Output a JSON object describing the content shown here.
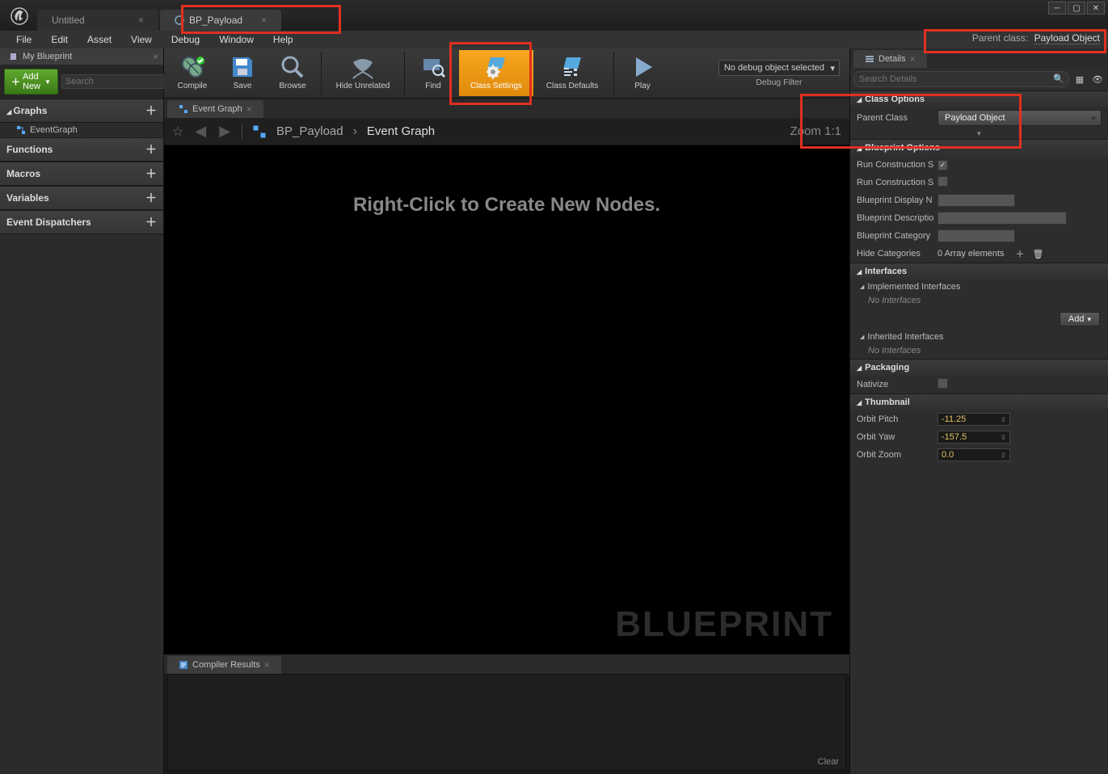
{
  "window": {
    "tabs": [
      {
        "label": "Untitled",
        "icon": "level"
      },
      {
        "label": "BP_Payload",
        "icon": "blueprint"
      }
    ]
  },
  "menubar": [
    "File",
    "Edit",
    "Asset",
    "View",
    "Debug",
    "Window",
    "Help"
  ],
  "parent_class_header": {
    "label": "Parent class:",
    "value": "Payload Object"
  },
  "my_blueprint": {
    "title": "My Blueprint",
    "add_new": "Add New",
    "search_placeholder": "Search",
    "sections": {
      "graphs": "Graphs",
      "event_graph": "EventGraph",
      "functions": "Functions",
      "macros": "Macros",
      "variables": "Variables",
      "event_dispatchers": "Event Dispatchers"
    }
  },
  "toolbar": {
    "compile": "Compile",
    "save": "Save",
    "browse": "Browse",
    "hide_unrelated": "Hide Unrelated",
    "find": "Find",
    "class_settings": "Class Settings",
    "class_defaults": "Class Defaults",
    "play": "Play",
    "debug_object": "No debug object selected",
    "debug_filter": "Debug Filter"
  },
  "graph": {
    "tab": "Event Graph",
    "breadcrumb_bp": "BP_Payload",
    "breadcrumb_graph": "Event Graph",
    "zoom": "Zoom 1:1",
    "hint": "Right-Click to Create New Nodes.",
    "watermark": "BLUEPRINT"
  },
  "compiler": {
    "tab": "Compiler Results",
    "clear": "Clear"
  },
  "details": {
    "title": "Details",
    "search_placeholder": "Search Details",
    "class_options": {
      "header": "Class Options",
      "parent_class_label": "Parent Class",
      "parent_class_value": "Payload Object"
    },
    "blueprint_options": {
      "header": "Blueprint Options",
      "run_construction_1": "Run Construction S",
      "run_construction_2": "Run Construction S",
      "display_name": "Blueprint Display N",
      "description": "Blueprint Descriptio",
      "category": "Blueprint Category",
      "hide_categories": "Hide Categories",
      "hide_categories_value": "0 Array elements"
    },
    "interfaces": {
      "header": "Interfaces",
      "implemented": "Implemented Interfaces",
      "none": "No Interfaces",
      "add": "Add",
      "inherited": "Inherited Interfaces"
    },
    "packaging": {
      "header": "Packaging",
      "nativize": "Nativize"
    },
    "thumbnail": {
      "header": "Thumbnail",
      "orbit_pitch_label": "Orbit Pitch",
      "orbit_pitch": "-11.25",
      "orbit_yaw_label": "Orbit Yaw",
      "orbit_yaw": "-157.5",
      "orbit_zoom_label": "Orbit Zoom",
      "orbit_zoom": "0.0"
    }
  }
}
